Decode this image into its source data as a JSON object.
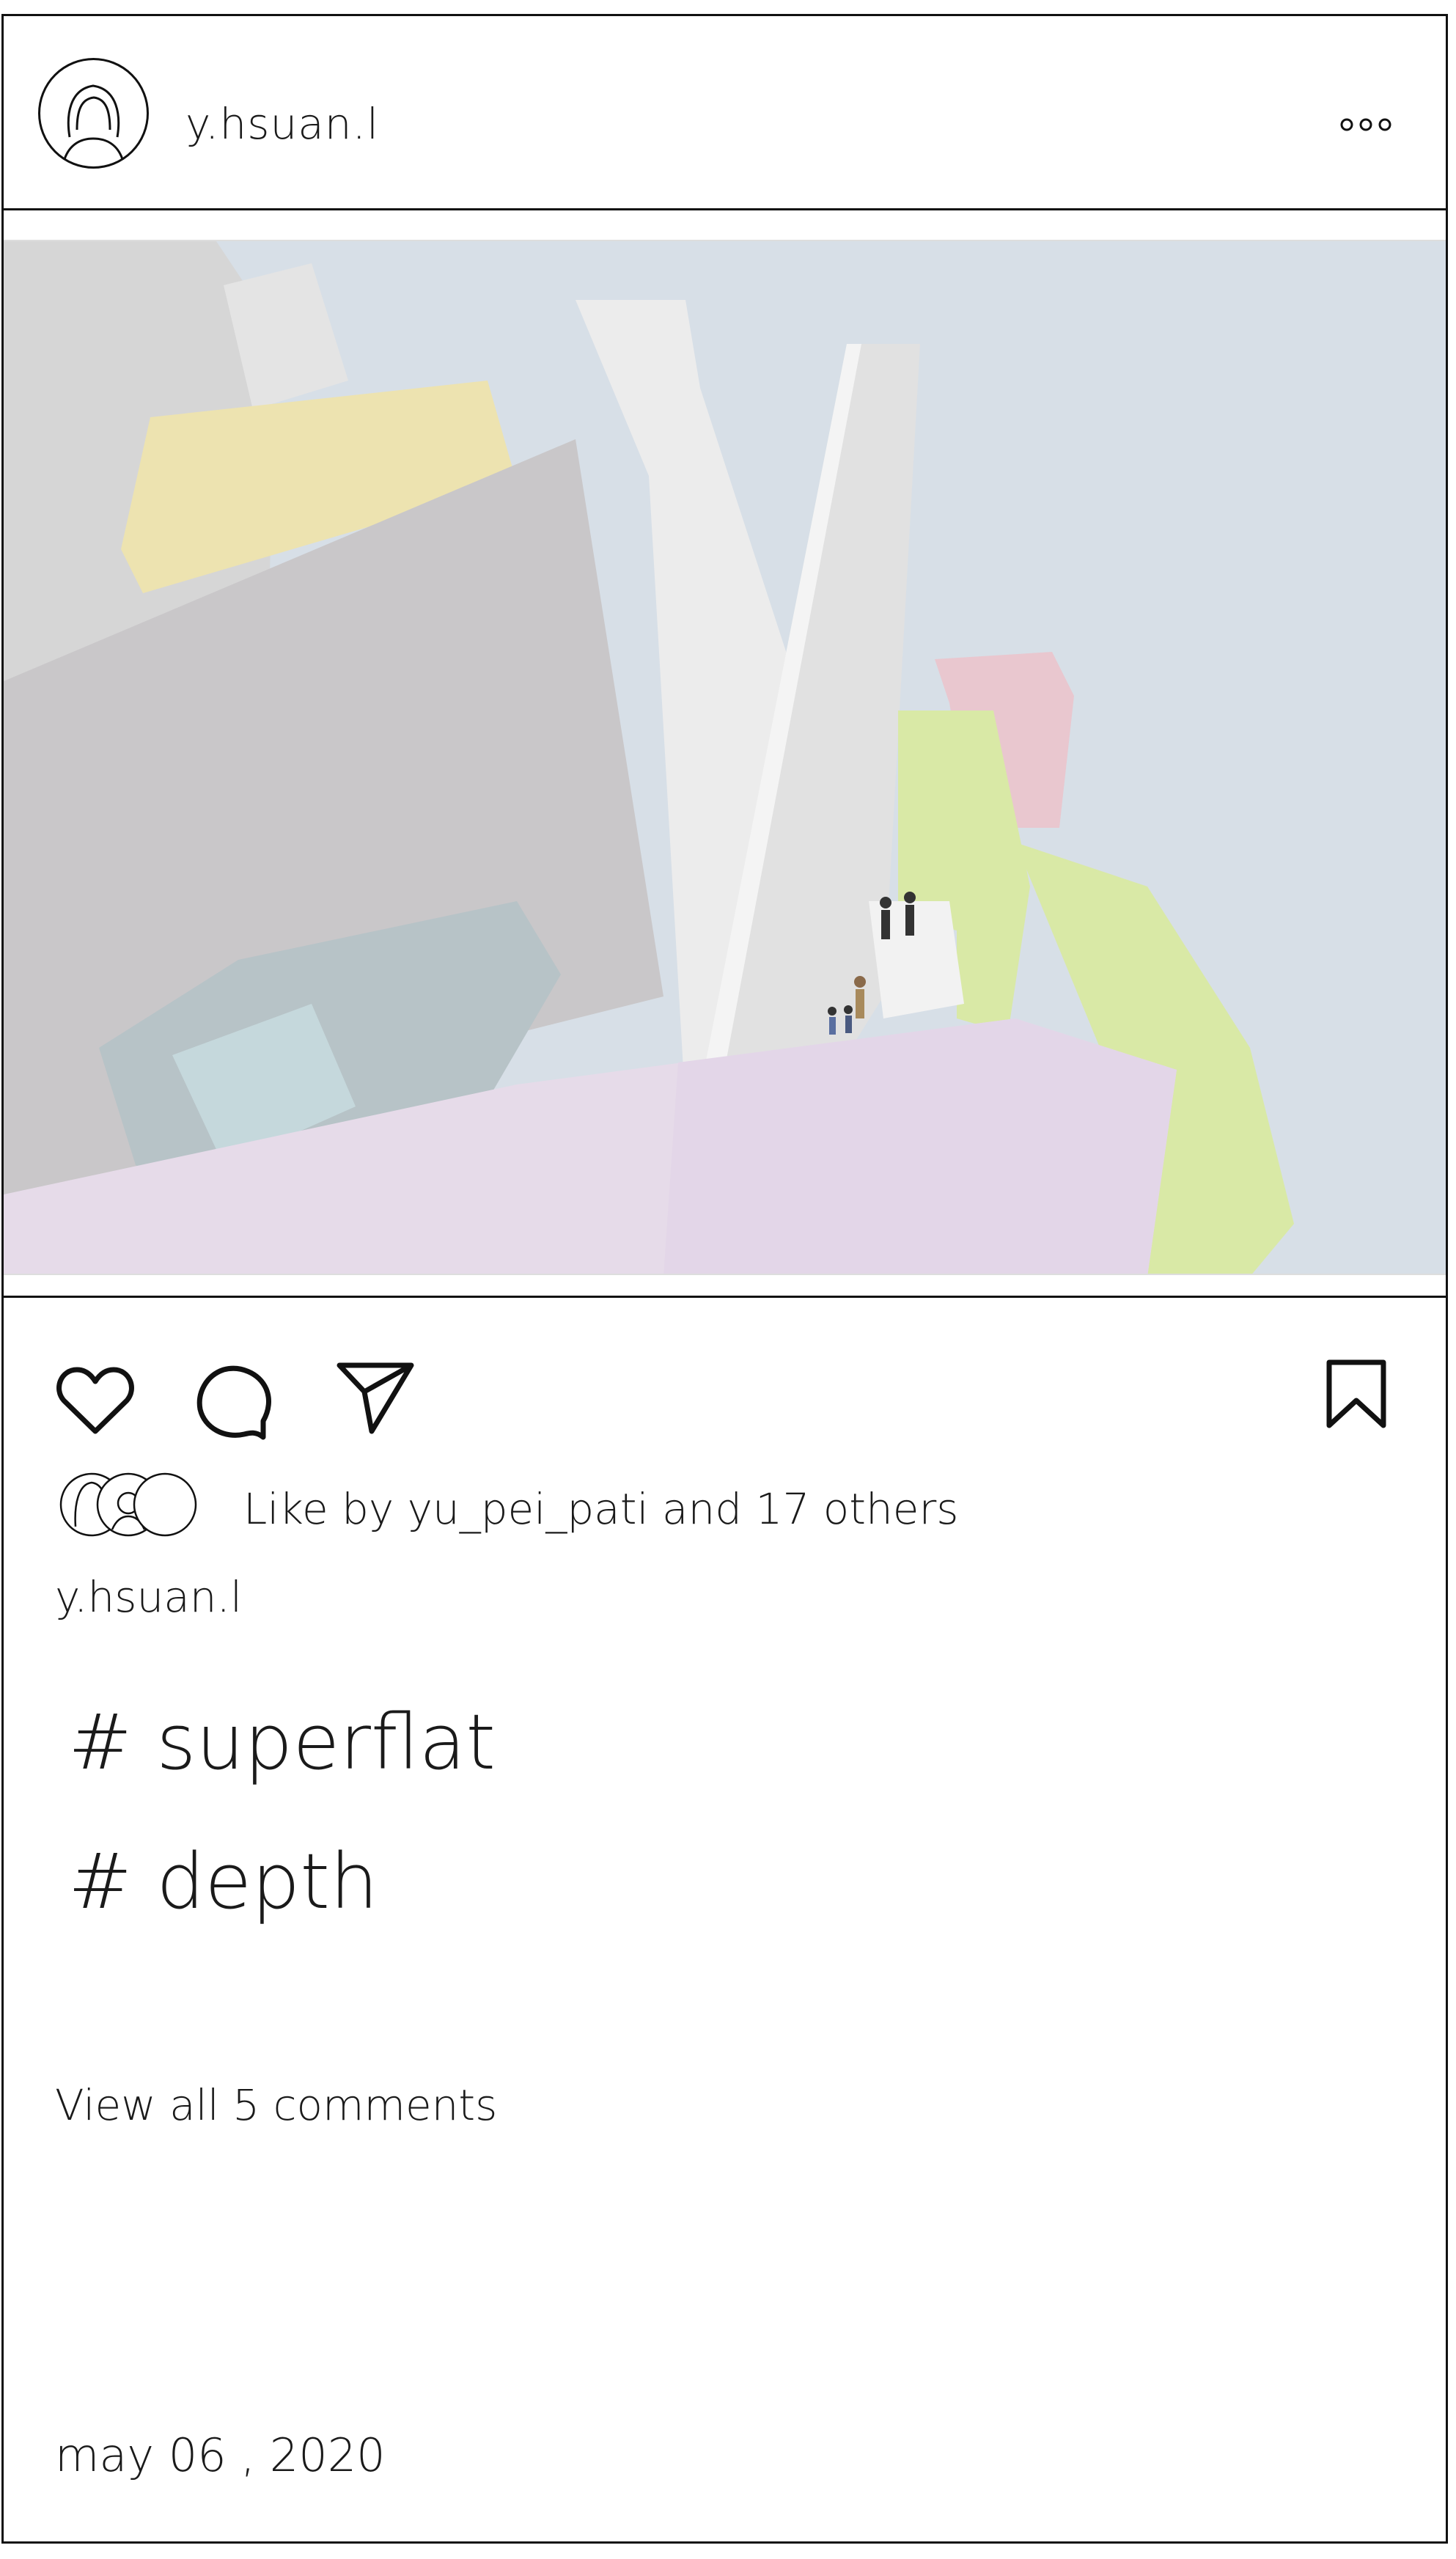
{
  "post": {
    "username": "y.hsuan.l",
    "likes_text": "Like by yu_pei_pati and 17 others",
    "caption_username": "y.hsuan.l",
    "hashtags": [
      "# superflat",
      "# depth"
    ],
    "view_comments": "View all 5 comments",
    "date": "may 06 , 2020"
  },
  "icons": {
    "more": "more-horizontal-icon",
    "like": "heart-icon",
    "comment": "comment-bubble-icon",
    "share": "send-paper-plane-icon",
    "save": "bookmark-icon"
  },
  "colors": {
    "stroke": "#111111",
    "sky": "#d6dee6",
    "concrete": "#d8d8d8",
    "yellow": "#ede3b0",
    "green": "#d9e9a6",
    "pink": "#e9c7cf",
    "lavender": "#e6dbe9",
    "teal": "#b7c3c7"
  }
}
